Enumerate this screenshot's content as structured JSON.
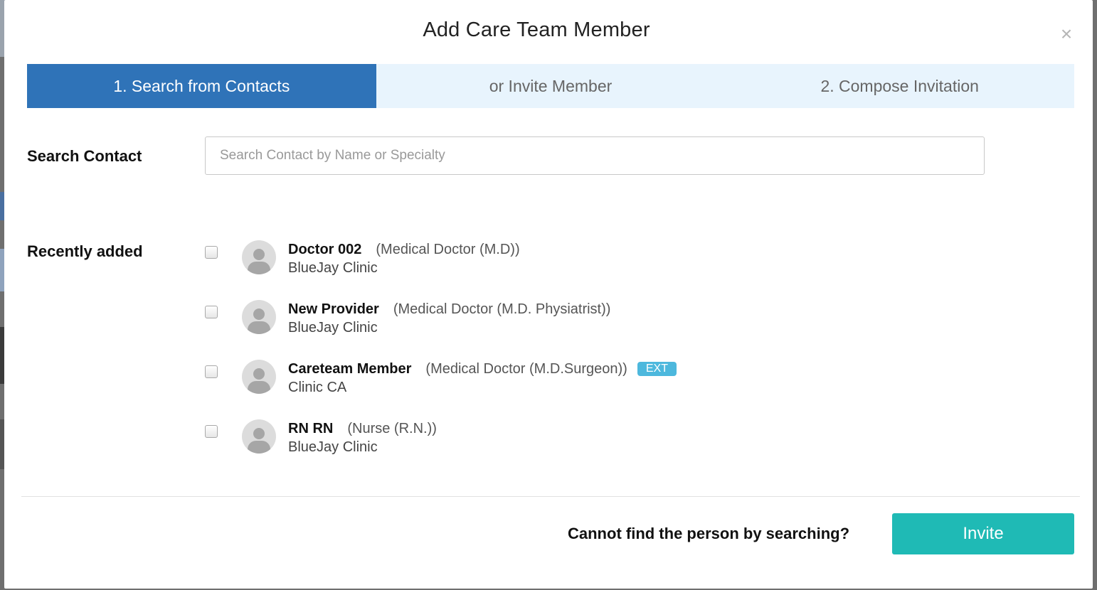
{
  "modal": {
    "title": "Add Care Team Member",
    "close_symbol": "×"
  },
  "steps": [
    {
      "label": "1. Search from Contacts",
      "active": true
    },
    {
      "label": "or Invite Member",
      "active": false
    },
    {
      "label": "2. Compose Invitation",
      "active": false
    }
  ],
  "search": {
    "label": "Search Contact",
    "placeholder": "Search Contact by Name or Specialty",
    "value": ""
  },
  "recent": {
    "label": "Recently added",
    "contacts": [
      {
        "name": "Doctor 002",
        "specialty": "(Medical Doctor (M.D))",
        "org": "BlueJay Clinic",
        "badge": "",
        "checked": false
      },
      {
        "name": "New Provider",
        "specialty": "(Medical Doctor (M.D. Physiatrist))",
        "org": "BlueJay Clinic",
        "badge": "",
        "checked": false
      },
      {
        "name": "Careteam Member",
        "specialty": "(Medical Doctor (M.D.Surgeon))",
        "org": "Clinic CA",
        "badge": "EXT",
        "checked": false
      },
      {
        "name": "RN RN",
        "specialty": "(Nurse (R.N.))",
        "org": "BlueJay Clinic",
        "badge": "",
        "checked": false
      }
    ]
  },
  "footer": {
    "prompt": "Cannot find the person by searching?",
    "invite_label": "Invite"
  },
  "colors": {
    "active_step": "#2f73b8",
    "step_bar": "#e8f4fd",
    "invite_button": "#1fbab5",
    "ext_badge": "#4db8dd"
  }
}
